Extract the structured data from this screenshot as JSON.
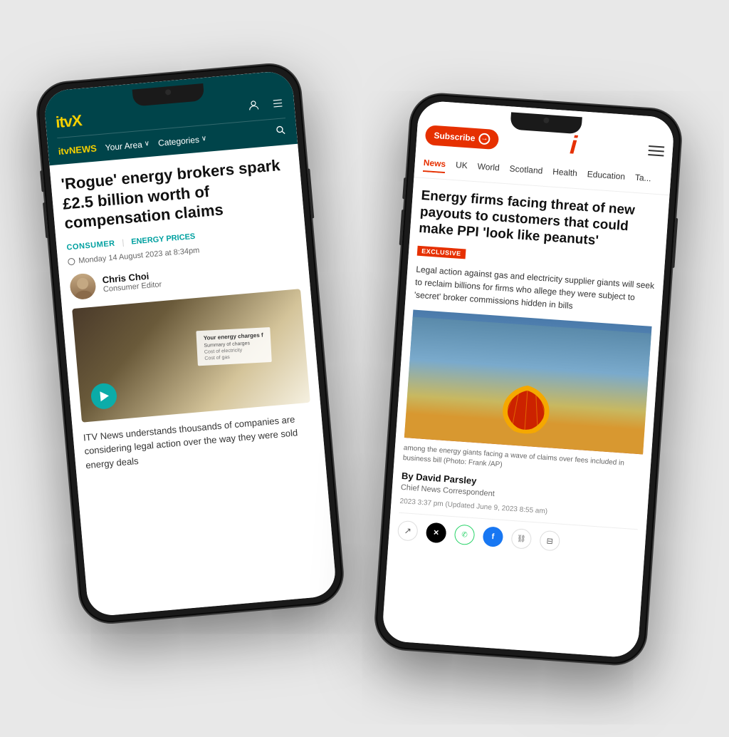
{
  "scene": {
    "background": "#e0ddd8"
  },
  "phone_left": {
    "label": "ITVX News phone",
    "header": {
      "logo_text": "itv",
      "logo_x": "X",
      "nav": {
        "news_label": "itvNEWS",
        "your_area": "Your Area",
        "categories": "Categories",
        "chevron": "›"
      }
    },
    "content": {
      "headline": "'Rogue' energy brokers spark £2.5 billion worth of compensation claims",
      "tag_consumer": "CONSUMER",
      "tag_divider": "|",
      "tag_energy": "ENERGY PRICES",
      "date": "Monday 14 August 2023 at 8:34pm",
      "author_name": "Chris Choi",
      "author_role": "Consumer Editor",
      "image_text1": "Your energy charges f",
      "image_text2": "Summary of charges",
      "image_text3": "Cost of electricity",
      "image_text4": "Cost of gas",
      "summary": "ITV News understands thousands of companies are considering legal action over the way they were sold energy deals"
    }
  },
  "phone_right": {
    "label": "i newspaper phone",
    "header": {
      "subscribe_label": "Subscribe",
      "logo": "i",
      "nav_items": [
        "News",
        "UK",
        "World",
        "Scotland",
        "Health",
        "Education",
        "Ta..."
      ]
    },
    "content": {
      "headline": "Energy firms facing threat of new payouts to customers that could make PPI 'look like peanuts'",
      "exclusive_badge": "EXCLUSIVE",
      "standfirst": "Legal action against gas and electricity supplier giants will seek to reclaim billions for firms who allege they were subject to 'secret' broker commissions hidden in bills",
      "caption": "among the energy giants facing a wave of claims over fees included in business bill (Photo: Frank /AP)",
      "author_name": "By David Parsley",
      "author_role": "Chief News Correspondent",
      "date": "2023 3:37 pm (Updated June 9, 2023 8:55 am)"
    }
  }
}
